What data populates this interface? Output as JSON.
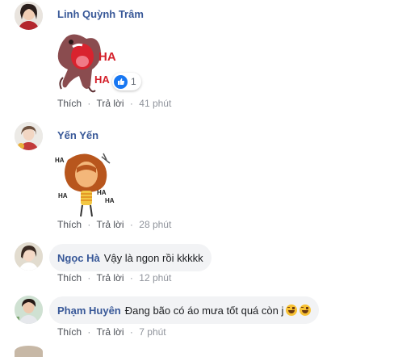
{
  "actions": {
    "like": "Thích",
    "reply": "Trả lời",
    "sep": "·"
  },
  "comments": [
    {
      "name": "Linh Quỳnh Trâm",
      "time": "41 phút",
      "sticker": "haha-dog-sticker",
      "reaction_count": "1",
      "reaction": "like-icon"
    },
    {
      "name": "Yến Yến",
      "time": "28 phút",
      "sticker": "haha-girl-sticker"
    },
    {
      "name": "Ngọc Hà",
      "text": "Vậy là ngon rồi kkkkk",
      "time": "12 phút"
    },
    {
      "name": "Phạm Huyên",
      "text": "Đang bão có áo mưa tốt quá còn j",
      "time": "7 phút",
      "emojis": [
        "rolling-laugh-emoji",
        "rolling-laugh-emoji"
      ]
    }
  ],
  "sticker_text": {
    "ha1": "HA",
    "ha2": "HA",
    "ha_small": "HA"
  },
  "colors": {
    "name": "#385898",
    "bubble": "#f2f3f5",
    "like": "#1877f2",
    "meta": "#90949c"
  }
}
